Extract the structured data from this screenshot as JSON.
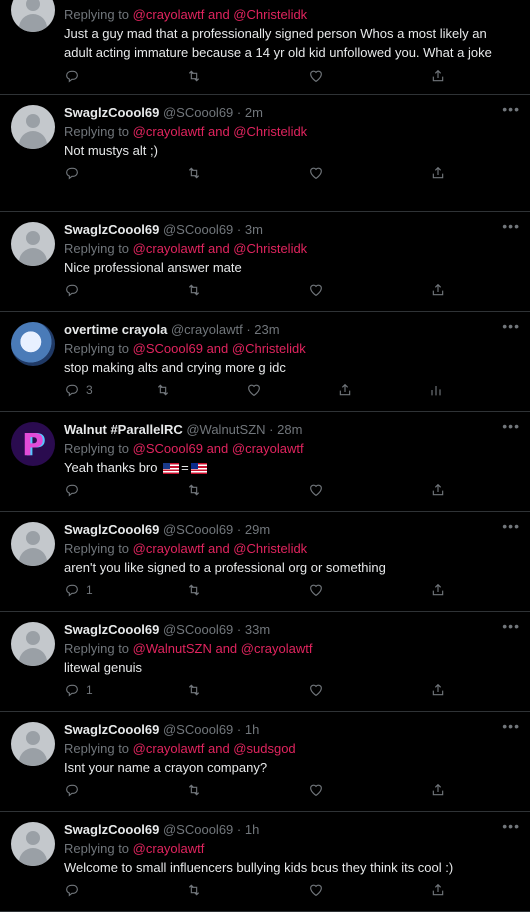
{
  "tweets": [
    {
      "name": "",
      "handle": "",
      "time": "",
      "replying_label": "Replying to",
      "mentions": "@crayolawtf and @Christelidk",
      "text": "Just a guy mad that a professionally signed person Whos a most likely an adult acting immature because a 14 yr old kid unfollowed you. What a joke",
      "reply_count": "",
      "avatar": "default-avatar"
    },
    {
      "name": "SwaglzCoool69",
      "handle": "@SCoool69",
      "time": "2m",
      "replying_label": "Replying to",
      "mentions": "@crayolawtf and @Christelidk",
      "text": "Not mustys alt ;)",
      "reply_count": "",
      "avatar": "default-avatar"
    },
    {
      "name": "SwaglzCoool69",
      "handle": "@SCoool69",
      "time": "3m",
      "replying_label": "Replying to",
      "mentions": "@crayolawtf and @Christelidk",
      "text": "Nice professional answer mate",
      "reply_count": "",
      "avatar": "default-avatar"
    },
    {
      "name": "overtime crayola",
      "handle": "@crayolawtf",
      "time": "23m",
      "replying_label": "Replying to",
      "mentions": "@SCoool69 and @Christelidk",
      "text": "stop making alts and crying more g idc",
      "reply_count": "3",
      "avatar": "character-avatar"
    },
    {
      "name": "Walnut #ParallelRC",
      "handle": "@WalnutSZN",
      "time": "28m",
      "replying_label": "Replying to",
      "mentions": "@SCoool69 and @crayolawtf",
      "text": "Yeah thanks bro",
      "text_suffix": "=",
      "reply_count": "",
      "avatar": "p-logo-avatar"
    },
    {
      "name": "SwaglzCoool69",
      "handle": "@SCoool69",
      "time": "29m",
      "replying_label": "Replying to",
      "mentions": "@crayolawtf and @Christelidk",
      "text": "aren't you like signed to a professional org or something",
      "reply_count": "1",
      "avatar": "default-avatar"
    },
    {
      "name": "SwaglzCoool69",
      "handle": "@SCoool69",
      "time": "33m",
      "replying_label": "Replying to",
      "mentions": "@WalnutSZN and @crayolawtf",
      "text": "litewal genuis",
      "reply_count": "1",
      "avatar": "default-avatar"
    },
    {
      "name": "SwaglzCoool69",
      "handle": "@SCoool69",
      "time": "1h",
      "replying_label": "Replying to",
      "mentions": "@crayolawtf and @sudsgod",
      "text": "Isnt your name a crayon company?",
      "reply_count": "",
      "avatar": "default-avatar"
    },
    {
      "name": "SwaglzCoool69",
      "handle": "@SCoool69",
      "time": "1h",
      "replying_label": "Replying to",
      "mentions": "@crayolawtf",
      "text": "Welcome to small influencers bullying kids bcus they think its cool :)",
      "reply_count": "",
      "avatar": "default-avatar"
    }
  ],
  "dot": "·",
  "more_icon": "more-horizontal-icon",
  "accent": "#e0245e",
  "icons": [
    "reply-icon",
    "retweet-icon",
    "like-icon",
    "share-icon",
    "analytics-icon"
  ]
}
